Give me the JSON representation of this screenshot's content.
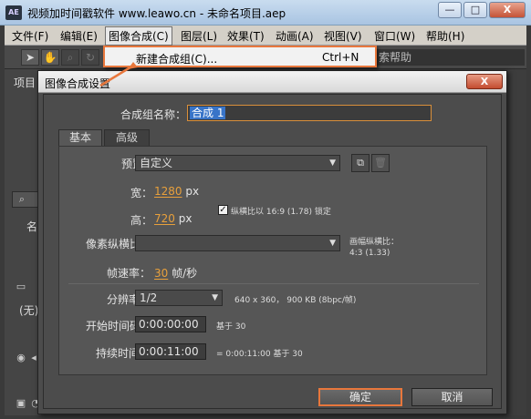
{
  "window": {
    "app_icon": "AE",
    "title": "视频加时间戳软件 www.leawo.cn - 未命名项目.aep",
    "min": "—",
    "max": "□",
    "close": "X"
  },
  "menubar": {
    "items": [
      "文件(F)",
      "编辑(E)",
      "图像合成(C)",
      "图层(L)",
      "效果(T)",
      "动画(A)",
      "视图(V)",
      "窗口(W)",
      "帮助(H)"
    ]
  },
  "toolbar": {
    "right_text": "索帮助"
  },
  "dropdown": {
    "item_label": "新建合成组(C)...",
    "item_shortcut": "Ctrl+N"
  },
  "left_panel": {
    "project_label": "项目",
    "col_letter": "名",
    "none_label": "(无)"
  },
  "dialog": {
    "title": "图像合成设置",
    "close": "X",
    "comp_name_label": "合成组名称：",
    "comp_name_value": "合成 1",
    "tabs": [
      "基本",
      "高级"
    ],
    "preset_label": "预置：",
    "preset_value": "自定义",
    "width_label": "宽：",
    "width_value": "1280",
    "width_unit": "px",
    "lock_label": "纵横比以 16:9 (1.78) 锁定",
    "height_label": "高：",
    "height_value": "720",
    "height_unit": "px",
    "pixel_aspect_label": "像素纵横比：",
    "pixel_aspect_value": "",
    "frame_aspect_label": "画幅纵横比：",
    "frame_aspect_value": "4:3 (1.33)",
    "frame_rate_label": "帧速率：",
    "frame_rate_value": "30",
    "frame_rate_unit": "帧/秒",
    "resolution_label": "分辨率：",
    "resolution_value": "1/2",
    "resolution_info": "640 x 360， 900 KB (8bpc/帧)",
    "start_tc_label": "开始时间码：",
    "start_tc_value": "0:00:00:00",
    "start_tc_note": "基于 30",
    "duration_label": "持续时间：",
    "duration_value": "0:00:11:00",
    "duration_note": "= 0:00:11:00 基于 30",
    "ok": "确定",
    "cancel": "取消"
  }
}
